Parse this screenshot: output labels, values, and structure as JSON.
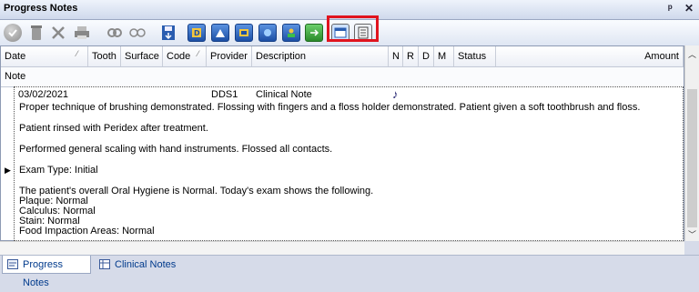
{
  "window": {
    "title": "Progress Notes",
    "pin_glyph": "ᵖ",
    "close_glyph": "✕"
  },
  "toolbar": {
    "icons": [
      "complete-check-icon",
      "delete-trash-icon",
      "tools-icon",
      "print-icon",
      "link-icon",
      "glasses-icon",
      "save-disk-icon",
      "tx-icon",
      "chart-icon",
      "exam-icon",
      "perio-icon",
      "patient-icon",
      "refresh-icon",
      "note-view-icon",
      "list-view-icon"
    ]
  },
  "grid": {
    "columns": [
      "Date",
      "Tooth",
      "Surface",
      "Code",
      "Provider",
      "Description",
      "N",
      "R",
      "D",
      "M",
      "Status",
      "Amount"
    ],
    "sub_header": "Note",
    "row": {
      "date": "03/02/2021",
      "provider": "DDS1",
      "description": "Clinical Note",
      "note_marker": "♪",
      "notes": [
        "Proper technique of brushing demonstrated.  Flossing with fingers and a floss holder demonstrated.  Patient given a soft toothbrush and floss.",
        "Patient rinsed with Peridex after treatment.",
        "Performed general scaling with hand instruments. Flossed all contacts.",
        "Exam Type:  Initial"
      ],
      "exam_summary": [
        "The patient's overall Oral Hygiene is Normal.  Today's exam shows the following.",
        "Plaque:  Normal",
        "Calculus:  Normal",
        "Stain:  Normal",
        "Food Impaction Areas:  Normal"
      ]
    }
  },
  "tabs": [
    {
      "label": "Progress Notes",
      "active": true
    },
    {
      "label": "Clinical Notes",
      "active": false
    }
  ],
  "colors": {
    "highlight": "#e0141e",
    "tab_text": "#003a8c"
  }
}
